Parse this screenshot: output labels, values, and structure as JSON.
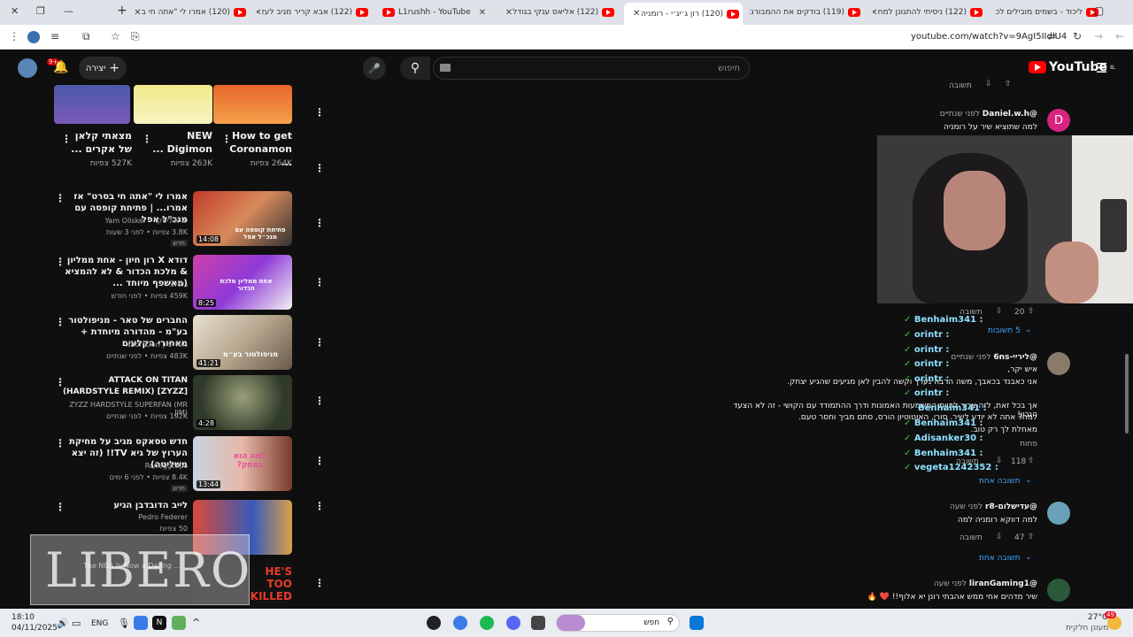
{
  "browser": {
    "tabs": [
      {
        "label": "ליכוד - בשמים מובילים לכ"
      },
      {
        "label": "(122) ניסיתי להתגונן למח"
      },
      {
        "label": "(119) בודקים את ההמבורג"
      },
      {
        "label": "(120) רון ג׳יג׳י - רומניה"
      },
      {
        "label": "(122) אליאס ענקי בגודל"
      },
      {
        "label": "L1rushh - YouTube"
      },
      {
        "label": "(122) אבא קריר מגיב לעז"
      },
      {
        "label": "(120) אמרו לי \"אתה חי ב"
      }
    ],
    "url": "youtube.com/watch?v=9AgI5IIdlU4"
  },
  "header": {
    "search_placeholder": "חיפוש",
    "create_label": "יצירה",
    "notif_count": "9+",
    "logo_text": "YouTube",
    "logo_country": "IL"
  },
  "shorts": [
    {
      "title": "How to get Coronamon ...",
      "views": "264K צפיות"
    },
    {
      "title": "NEW Digimon ...",
      "views": "263K צפיות"
    },
    {
      "title": "מצאתי קלאן של אקרים ...",
      "views": "527K צפיות"
    }
  ],
  "videos": [
    {
      "title": "אמרו לי \"אתה חי בסרט\" אז אמרו... | פתיחת קופסה עם מנכ\"ל אפל",
      "channel": "ים אוליסקר - Yam Olisker",
      "meta": "3.8K צפיות • לפני 3 שעות",
      "badge": "חדש",
      "duration": "14:08",
      "thumb_text": "פתיחת קופסה עם מנכ״ל אפל"
    },
    {
      "title": "דודא X רון חיון - אחת ממליון & מלכת הכדור & לא להמציא (מאשפף מיוחד ...",
      "channel": "גלגלצ",
      "meta": "459K צפיות • לפני חודש",
      "duration": "8:25",
      "thumb_text": "אחת ממליון מלכת הכדור"
    },
    {
      "title": "החברים של טאר - מניפולטור בע\"מ - מהדורה מיוחדת + מאחורי הקלעים",
      "channel": "נאור ציון Naor Zion",
      "meta": "483K צפיות • לפני שנתיים",
      "duration": "41:21",
      "thumb_text": "מניפולטור בע״מ"
    },
    {
      "title": "ATTACK ON TITAN (HARDSTYLE REMIX) [ZYZZ]",
      "channel": "ZYZZ HARDSTYLE SUPERFAN (MR JIM)",
      "meta": "192K צפיות • לפני שנתיים",
      "duration": "4:28"
    },
    {
      "title": "חדש טסאקס מגיב על מחיקת הערוץ של גיא TV!! (זה יצא משליטה)",
      "channel": "Roneggclips",
      "meta": "8.4K צפיות • לפני 6 ימים",
      "badge": "חדש",
      "duration": "13:44",
      "thumb_text": "למה הוא נמחק?"
    },
    {
      "title": "לייב הדובדבן הגיע",
      "channel": "Pedro Federer",
      "meta": "50 צפיות",
      "thumb_text": "HE'S TOO KILLED"
    }
  ],
  "overlay": {
    "libero": "LIBERO",
    "libero_sub": "The NBA Is Now a Dating ..."
  },
  "comments": [
    {
      "author": "@Daniel.w.h",
      "time": "לפני שנתיים",
      "text": "למה שתוציא שיר על רומניה",
      "avatar_letter": "D",
      "likes": "20",
      "reply": "תשובה",
      "replies_link": "5 תשובות"
    },
    {
      "author": "@ליריי-6ns",
      "time": "לפני שנתיים",
      "lines": [
        "איש יקר,",
        "אני כאבנד בכאבך, משה הרבה נערך וקשה להבין לאן מגיעים שהגיע יצחק.",
        "אך בכל זאת, לזה צריך להיות המשמעות האמונות ודרך ההתמודד עם הקושי - זה לא הצעד הנכון!",
        "למה? אתה לא יודע לשיר. סורי, האוטוטיון הורס, סתם מביך וחסר טעם.",
        "מאחלת לך רק טוב."
      ],
      "more": "פחות",
      "likes": "118",
      "reply": "תשובה",
      "replies_link": "תשובה אחת"
    },
    {
      "author": "@עדישלום-r8",
      "time": "לפני שעה",
      "text": "למה דווקא רומניה למה",
      "likes": "47",
      "reply": "תשובה",
      "replies_link": "תשובה אחת"
    },
    {
      "author": "@liranGaming1",
      "time": "לפני שעה",
      "text": "שיר מדהים אחי ממש אהבתי רונן יא אלוף!! ❤️ 🔥"
    }
  ],
  "top_reply_label": "תשובה",
  "chat": [
    {
      "user": "Benhaim341"
    },
    {
      "user": "orintr"
    },
    {
      "user": "orintr"
    },
    {
      "user": "orintr"
    },
    {
      "user": "orintr"
    },
    {
      "user": "orintr"
    },
    {
      "user": "Benhaim341"
    },
    {
      "user": "Benhaim341"
    },
    {
      "user": "Adisanker30"
    },
    {
      "user": "Benhaim341"
    },
    {
      "user": "vegeta1242352"
    }
  ],
  "taskbar": {
    "time": "18:10",
    "date": "04/11/2025",
    "lang": "ENG",
    "search": "חפש",
    "weather_temp": "27°C",
    "weather_desc": "מעונן חלקית",
    "weather_badge": "49"
  }
}
